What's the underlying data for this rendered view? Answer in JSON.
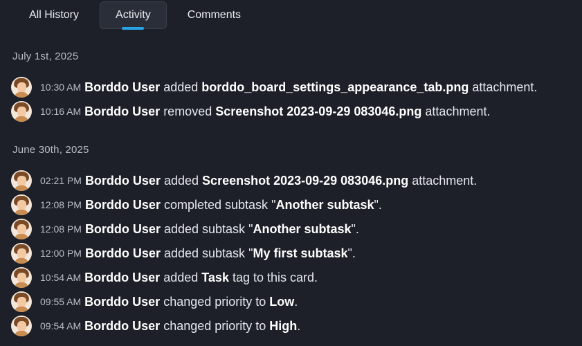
{
  "tabs": [
    {
      "label": "All History",
      "active": false
    },
    {
      "label": "Activity",
      "active": true
    },
    {
      "label": "Comments",
      "active": false
    }
  ],
  "accent_color": "#2aa3e6",
  "groups": [
    {
      "date": "July 1st, 2025",
      "entries": [
        {
          "time": "10:30 AM",
          "user": "Borddo User",
          "action": "added",
          "quote_open": "",
          "object": "borddo_board_settings_appearance_tab.png",
          "quote_close": "",
          "suffix": "attachment."
        },
        {
          "time": "10:16 AM",
          "user": "Borddo User",
          "action": "removed",
          "quote_open": "",
          "object": "Screenshot 2023-09-29 083046.png",
          "quote_close": "",
          "suffix": "attachment."
        }
      ]
    },
    {
      "date": "June 30th, 2025",
      "entries": [
        {
          "time": "02:21 PM",
          "user": "Borddo User",
          "action": "added",
          "quote_open": "",
          "object": "Screenshot 2023-09-29 083046.png",
          "quote_close": "",
          "suffix": "attachment."
        },
        {
          "time": "12:08 PM",
          "user": "Borddo User",
          "action": "completed subtask",
          "quote_open": "\"",
          "object": "Another subtask",
          "quote_close": "\".",
          "suffix": ""
        },
        {
          "time": "12:08 PM",
          "user": "Borddo User",
          "action": "added subtask",
          "quote_open": "\"",
          "object": "Another subtask",
          "quote_close": "\".",
          "suffix": ""
        },
        {
          "time": "12:00 PM",
          "user": "Borddo User",
          "action": "added subtask",
          "quote_open": "\"",
          "object": "My first subtask",
          "quote_close": "\".",
          "suffix": ""
        },
        {
          "time": "10:54 AM",
          "user": "Borddo User",
          "action": "added",
          "quote_open": "",
          "object": "Task",
          "quote_close": "",
          "suffix": "tag to this card."
        },
        {
          "time": "09:55 AM",
          "user": "Borddo User",
          "action": "changed priority to",
          "quote_open": "",
          "object": "Low",
          "quote_close": ".",
          "suffix": ""
        },
        {
          "time": "09:54 AM",
          "user": "Borddo User",
          "action": "changed priority to",
          "quote_open": "",
          "object": "High",
          "quote_close": ".",
          "suffix": ""
        }
      ]
    }
  ]
}
